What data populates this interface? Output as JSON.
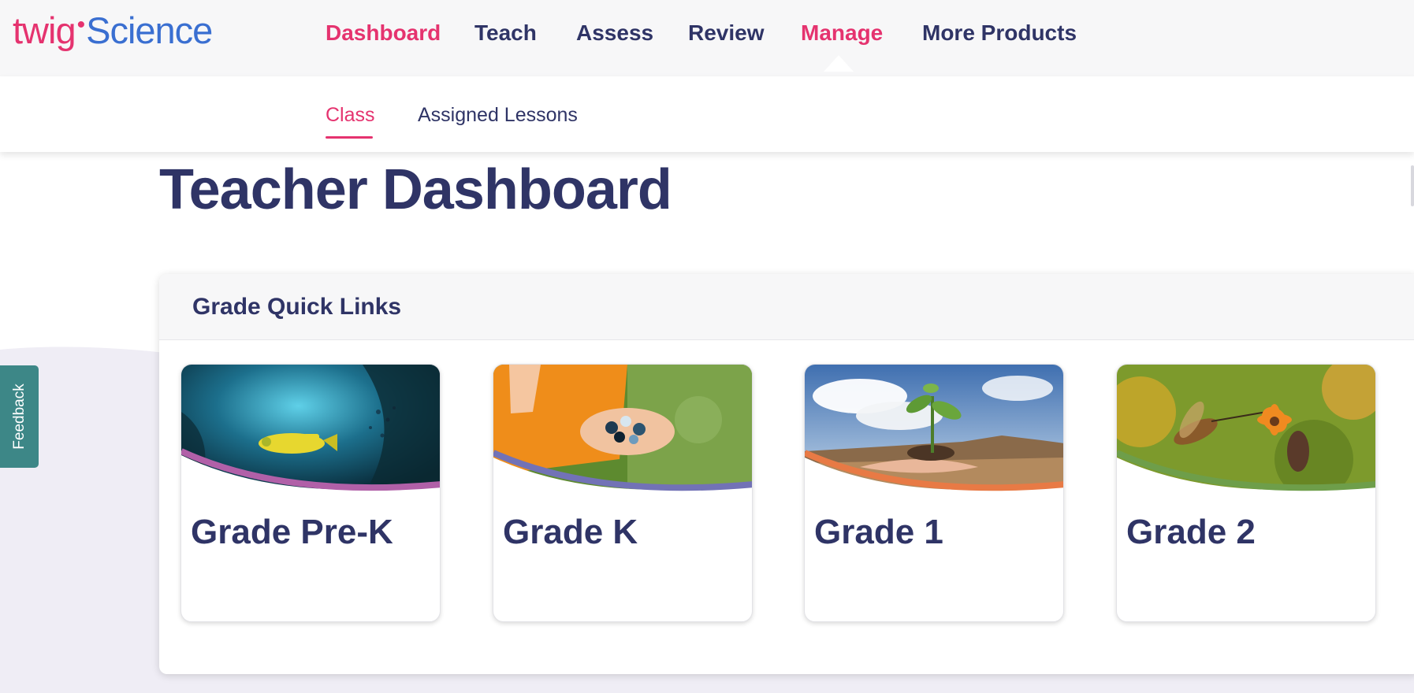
{
  "logo": {
    "part1": "twig",
    "part2": "Science"
  },
  "nav": {
    "items": [
      {
        "label": "Dashboard",
        "color": "#e5336f"
      },
      {
        "label": "Teach",
        "color": "#2f3466"
      },
      {
        "label": "Assess",
        "color": "#2f3466"
      },
      {
        "label": "Review",
        "color": "#2f3466"
      },
      {
        "label": "Manage",
        "color": "#e5336f"
      },
      {
        "label": "More Products",
        "color": "#2f3466"
      }
    ],
    "active": "Manage"
  },
  "subnav": {
    "items": [
      {
        "label": "Class"
      },
      {
        "label": "Assigned Lessons"
      }
    ],
    "active": "Class"
  },
  "page": {
    "title": "Teacher Dashboard"
  },
  "quick_links": {
    "title": "Grade Quick Links",
    "cards": [
      {
        "label": "Grade Pre-K",
        "accent": "#b160a8",
        "image": "underwater-submarine"
      },
      {
        "label": "Grade K",
        "accent": "#7272b6",
        "image": "hands-holding-marbles"
      },
      {
        "label": "Grade 1",
        "accent": "#e87a45",
        "image": "hands-holding-seedling"
      },
      {
        "label": "Grade 2",
        "accent": "#6e9e4a",
        "image": "moth-on-flower"
      }
    ]
  },
  "feedback": {
    "label": "Feedback"
  },
  "colors": {
    "brand_pink": "#e5336f",
    "brand_blue": "#3a6fd1",
    "navy": "#2f3466",
    "feedback_teal": "#3d8787"
  }
}
